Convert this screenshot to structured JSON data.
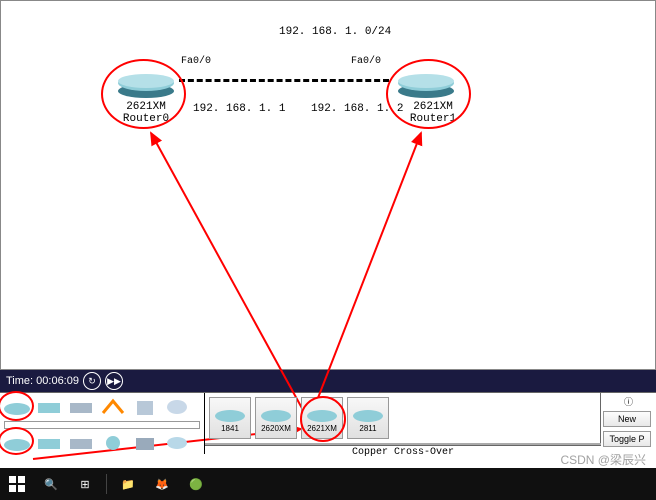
{
  "topology": {
    "subnet": "192. 168. 1. 0/24",
    "routers": [
      {
        "name": "2621XM\nRouter0",
        "port": "Fa0/0",
        "ip": "192. 168. 1. 1"
      },
      {
        "name": "2621XM\nRouter1",
        "port": "Fa0/0",
        "ip": "192. 168. 1. 2"
      }
    ]
  },
  "time": {
    "label": "Time:",
    "value": "00:06:09"
  },
  "devices": [
    {
      "label": "1841"
    },
    {
      "label": "2620XM"
    },
    {
      "label": "2621XM"
    },
    {
      "label": "2811"
    }
  ],
  "cable": "Copper Cross-Over",
  "right": {
    "new": "New",
    "toggle": "Toggle P"
  },
  "watermark": "CSDN @梁辰兴"
}
